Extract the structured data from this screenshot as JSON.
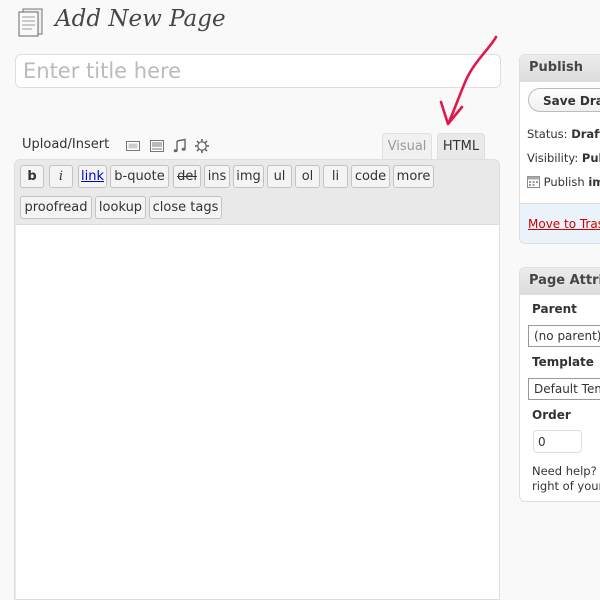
{
  "header": {
    "title": "Add New Page",
    "icon": "page-icon"
  },
  "title_field": {
    "value": "",
    "placeholder": "Enter title here"
  },
  "media_buttons": {
    "label": "Upload/Insert",
    "icons": [
      "image-icon",
      "video-icon",
      "audio-icon",
      "media-icon"
    ]
  },
  "editor_tabs": [
    {
      "label": "Visual",
      "active": false
    },
    {
      "label": "HTML",
      "active": true
    }
  ],
  "quicktags": {
    "row1": [
      "b",
      "i",
      "link",
      "b-quote",
      "del",
      "ins",
      "img",
      "ul",
      "ol",
      "li",
      "code",
      "more"
    ],
    "row2": [
      "proofread",
      "lookup",
      "close tags"
    ]
  },
  "annotation": {
    "arrow_icon": "red-arrow-icon",
    "color": "#e0184b"
  },
  "publish_box": {
    "title": "Publish",
    "save_label": "Save Draft",
    "status_label": "Status:",
    "status_value": "Draft",
    "visibility_label": "Visibility:",
    "visibility_value": "Public",
    "publish_label": "Publish",
    "publish_value": "immediately",
    "trash_label": "Move to Trash"
  },
  "attributes_box": {
    "title": "Page Attributes",
    "parent_label": "Parent",
    "parent_value": "(no parent)",
    "template_label": "Template",
    "template_value": "Default Template",
    "order_label": "Order",
    "order_value": "0",
    "help_line1": "Need help? Use the Help tab in the upper",
    "help_line2": "right of your screen."
  },
  "colors": {
    "accent": "#21759b",
    "trash": "#cc0000",
    "arrow": "#e0184b",
    "background": "#f9f9f9"
  }
}
